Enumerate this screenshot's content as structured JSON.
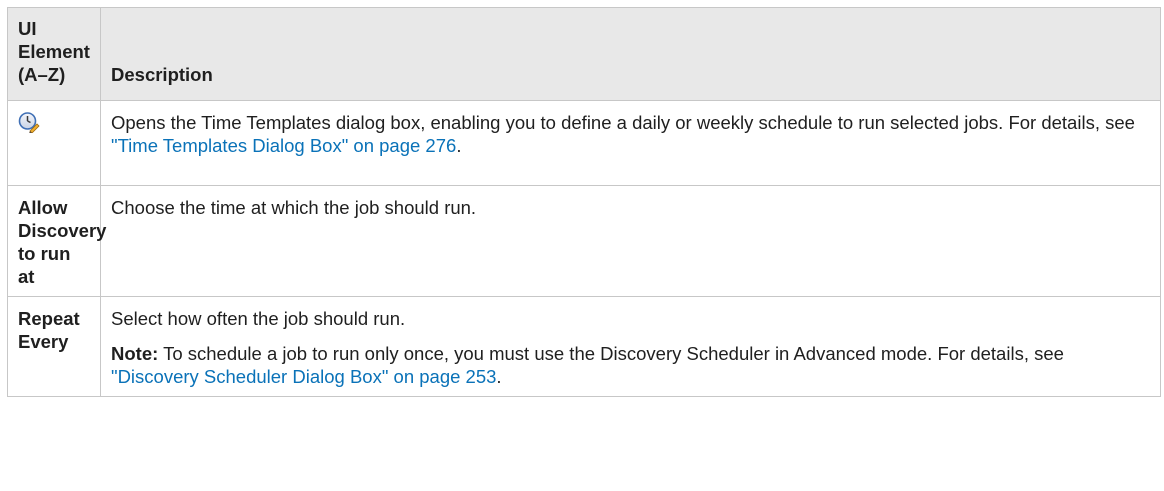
{
  "table": {
    "headers": {
      "element": "UI Element (A–Z)",
      "description": "Description"
    },
    "rows": [
      {
        "element_icon": "time-templates-clock-icon",
        "description": {
          "text_before": "Opens the Time Templates dialog box, enabling you to define a daily or weekly schedule to run selected jobs. For details, see ",
          "link": "\"Time Templates Dialog Box\" on page 276",
          "text_after": "."
        }
      },
      {
        "element": "Allow Discovery to run at",
        "description": {
          "text": "Choose the time at which the job should run."
        }
      },
      {
        "element": "Repeat Every",
        "description": {
          "text": "Select how often the job should run.",
          "note_label": "Note:",
          "note_text": " To schedule a job to run only once, you must use the Discovery Scheduler in Advanced mode. For details, see ",
          "note_link": "\"Discovery Scheduler Dialog Box\" on page 253",
          "note_after": "."
        }
      }
    ]
  },
  "colors": {
    "header_bg": "#e8e8e8",
    "border": "#c7c7c7",
    "link": "#0a72b8"
  }
}
